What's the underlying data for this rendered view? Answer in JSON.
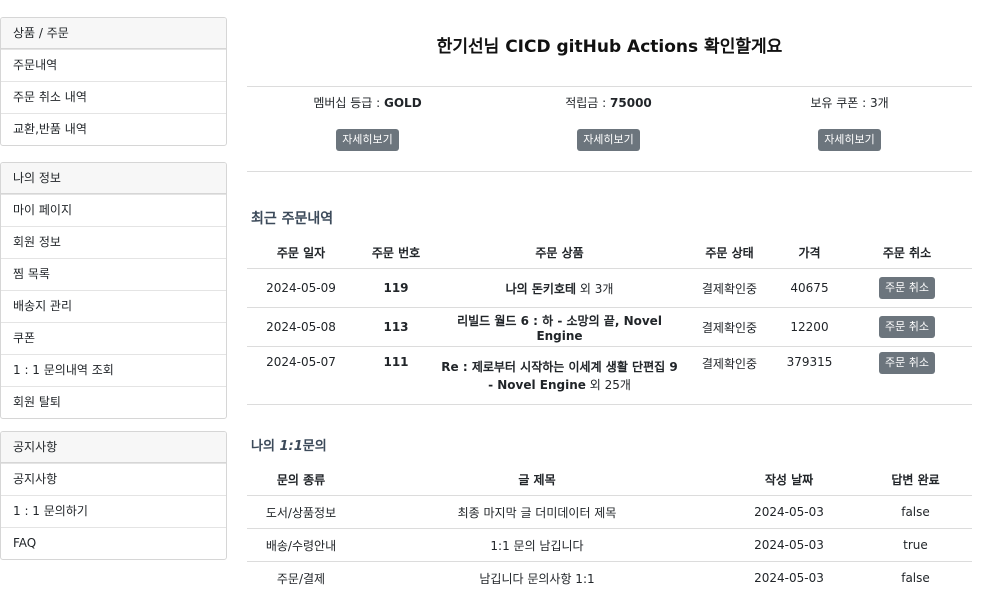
{
  "sidebar": {
    "sections": [
      {
        "title": "상품 / 주문",
        "items": [
          "주문내역",
          "주문 취소 내역",
          "교환,반품 내역"
        ]
      },
      {
        "title": "나의 정보",
        "items": [
          "마이 페이지",
          "회원 정보",
          "찜 목록",
          "배송지 관리",
          "쿠폰",
          "1 : 1 문의내역 조회",
          "회원 탈퇴"
        ]
      },
      {
        "title": "공지사항",
        "items": [
          "공지사항",
          "1 : 1 문의하기",
          "FAQ"
        ]
      }
    ]
  },
  "header": {
    "title": "한기선님 CICD gitHub Actions 확인할게요"
  },
  "summary": {
    "membership": {
      "label": "멤버십 등급 : ",
      "value": "GOLD",
      "button": "자세히보기"
    },
    "points": {
      "label": "적립금 : ",
      "value": "75000",
      "button": "자세히보기"
    },
    "coupons": {
      "label": "보유 쿠폰 : 3개",
      "button": "자세히보기"
    }
  },
  "recent_orders": {
    "title": "최근 주문내역",
    "columns": [
      "주문 일자",
      "주문 번호",
      "주문 상품",
      "주문 상태",
      "가격",
      "주문 취소"
    ],
    "rows": [
      {
        "date": "2024-05-09",
        "number": "119",
        "product": "나의 돈키호테",
        "suffix": " 외 3개",
        "status": "결제확인중",
        "price": "40675",
        "action": "주문 취소"
      },
      {
        "date": "2024-05-08",
        "number": "113",
        "product": "리빌드 월드 6 : 하 - 소망의 끝, Novel Engine",
        "suffix": "",
        "status": "결제확인중",
        "price": "12200",
        "action": "주문 취소"
      },
      {
        "date": "2024-05-07",
        "number": "111",
        "product": "Re : 제로부터 시작하는 이세계 생활 단편집 9 - Novel Engine",
        "suffix": " 외 25개",
        "status": "결제확인중",
        "price": "379315",
        "action": "주문 취소"
      }
    ]
  },
  "inquiries": {
    "title_prefix": "나의 ",
    "title_em": "1:1",
    "title_suffix": "문의",
    "columns": [
      "문의 종류",
      "글 제목",
      "작성 날짜",
      "답변 완료"
    ],
    "rows": [
      {
        "type": "도서/상품정보",
        "subject": "최종 마지막 글 더미데이터 제목",
        "date": "2024-05-03",
        "answered": "false"
      },
      {
        "type": "배송/수령안내",
        "subject": "1:1 문의 남깁니다",
        "date": "2024-05-03",
        "answered": "true"
      },
      {
        "type": "주문/결제",
        "subject": "남깁니다 문의사항 1:1",
        "date": "2024-05-03",
        "answered": "false"
      }
    ]
  }
}
